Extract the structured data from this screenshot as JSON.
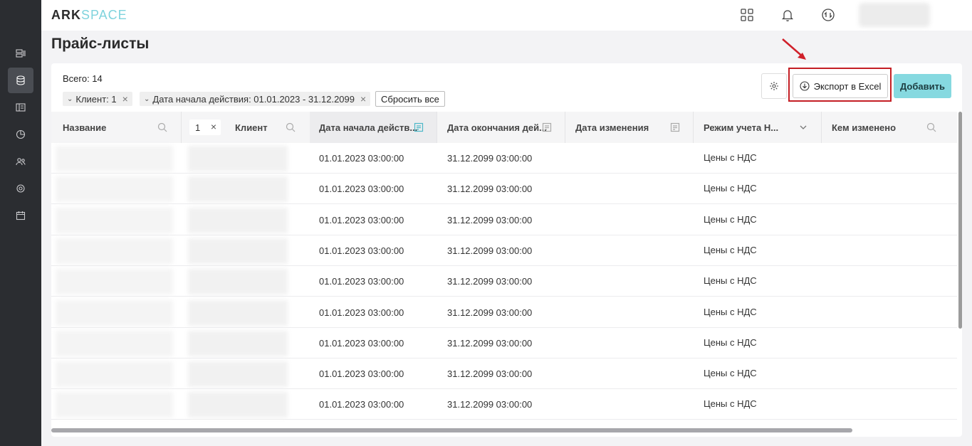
{
  "app": {
    "logo_main": "ARK",
    "logo_accent": "SPACE"
  },
  "page": {
    "title": "Прайс-листы"
  },
  "toolbar": {
    "total": "Всего: 14",
    "filters": [
      {
        "label": "Клиент: 1"
      },
      {
        "label": "Дата начала действия: 01.01.2023 - 31.12.2099"
      }
    ],
    "reset_label": "Сбросить все",
    "export_label": "Экспорт в Excel",
    "add_label": "Добавить"
  },
  "table": {
    "columns": {
      "name": "Название",
      "client_filter_value": "1",
      "client": "Клиент",
      "start_date": "Дата начала действ...",
      "end_date": "Дата окончания дей...",
      "changed_date": "Дата изменения",
      "vat_mode": "Режим учета Н...",
      "changed_by": "Кем изменено"
    },
    "rows": [
      {
        "start": "01.01.2023 03:00:00",
        "end": "31.12.2099 03:00:00",
        "vat": "Цены с НДС"
      },
      {
        "start": "01.01.2023 03:00:00",
        "end": "31.12.2099 03:00:00",
        "vat": "Цены с НДС"
      },
      {
        "start": "01.01.2023 03:00:00",
        "end": "31.12.2099 03:00:00",
        "vat": "Цены с НДС"
      },
      {
        "start": "01.01.2023 03:00:00",
        "end": "31.12.2099 03:00:00",
        "vat": "Цены с НДС"
      },
      {
        "start": "01.01.2023 03:00:00",
        "end": "31.12.2099 03:00:00",
        "vat": "Цены с НДС"
      },
      {
        "start": "01.01.2023 03:00:00",
        "end": "31.12.2099 03:00:00",
        "vat": "Цены с НДС"
      },
      {
        "start": "01.01.2023 03:00:00",
        "end": "31.12.2099 03:00:00",
        "vat": "Цены с НДС"
      },
      {
        "start": "01.01.2023 03:00:00",
        "end": "31.12.2099 03:00:00",
        "vat": "Цены с НДС"
      },
      {
        "start": "01.01.2023 03:00:00",
        "end": "31.12.2099 03:00:00",
        "vat": "Цены с НДС"
      }
    ]
  },
  "colors": {
    "accent": "#86d9e0",
    "highlight": "#c41e24",
    "sidebar": "#2b2d31"
  }
}
